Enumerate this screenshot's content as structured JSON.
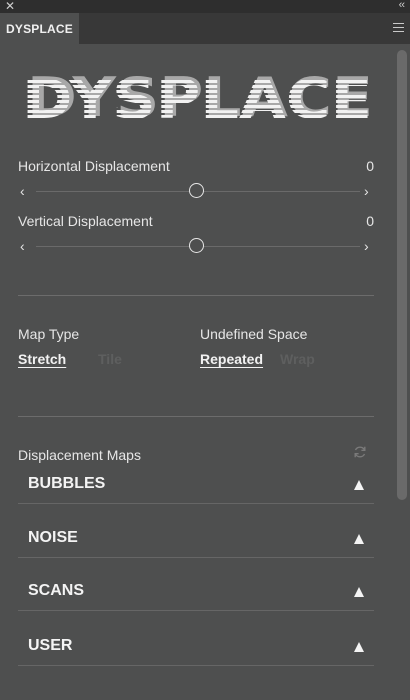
{
  "window": {
    "close_glyph": "✕",
    "collapse_glyph": "‹‹"
  },
  "tab": {
    "label": "DYSPLACE"
  },
  "logo": {
    "text": "DYSPLACE"
  },
  "horizontal": {
    "label": "Horizontal Displacement",
    "value": "0",
    "left_arrow": "‹",
    "right_arrow": "›"
  },
  "vertical": {
    "label": "Vertical Displacement",
    "value": "0",
    "left_arrow": "‹",
    "right_arrow": "›"
  },
  "map_type": {
    "label": "Map Type",
    "options": [
      "Stretch",
      "Tile"
    ],
    "selected": "Stretch"
  },
  "undefined_space": {
    "label": "Undefined Space",
    "options": [
      "Repeated",
      "Wrap"
    ],
    "selected": "Repeated"
  },
  "displacement_maps": {
    "label": "Displacement Maps",
    "items": [
      {
        "name": "BUBBLES"
      },
      {
        "name": "NOISE"
      },
      {
        "name": "SCANS"
      },
      {
        "name": "USER"
      }
    ]
  },
  "colors": {
    "panel_bg": "#4e4f4f",
    "tab_bar": "#383838",
    "chrome": "#2e2e2e",
    "text": "#e6e6e6",
    "inactive_text": "#5e5f5f"
  }
}
